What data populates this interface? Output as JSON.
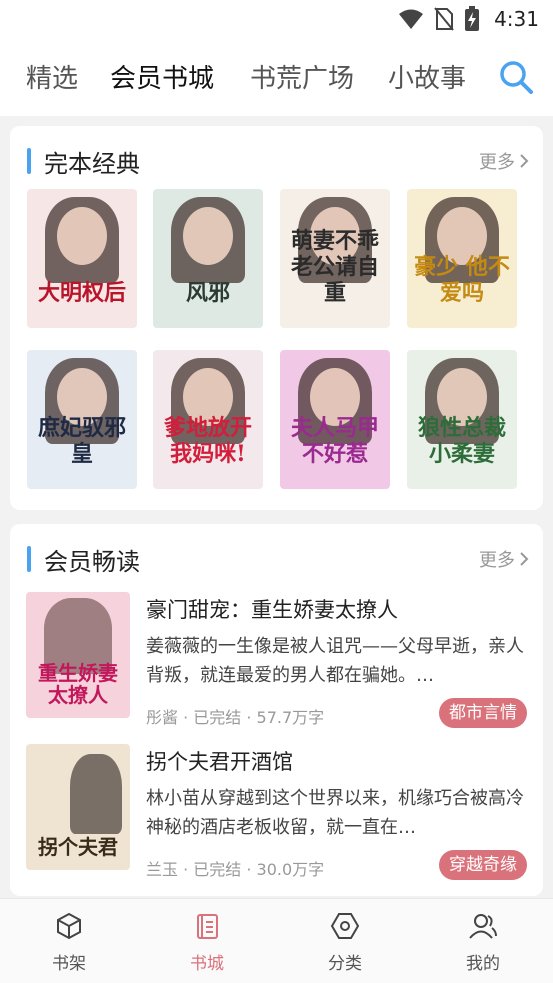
{
  "status_bar": {
    "time": "4:31"
  },
  "top_nav": {
    "tabs": [
      {
        "label": "精选",
        "active": false
      },
      {
        "label": "会员书城",
        "active": true
      },
      {
        "label": "书荒广场",
        "active": false
      },
      {
        "label": "小故事",
        "active": false
      }
    ],
    "search_icon": "search-icon",
    "accent_color": "#4aa3f0"
  },
  "section_classic": {
    "title": "完本经典",
    "more": "更多",
    "covers": [
      {
        "title": "大明权后",
        "bg": "#f6e6e6",
        "color": "#b8142a"
      },
      {
        "title": "风邪",
        "bg": "#dfe9e4",
        "color": "#2c3a36"
      },
      {
        "title": "萌妻不乖 老公请自重",
        "bg": "#f5efe8",
        "color": "#2b2b2b"
      },
      {
        "title": "豪少 他不爱吗",
        "bg": "#f7eed2",
        "color": "#c58a12"
      },
      {
        "title": "庶妃驭邪皇",
        "bg": "#e6ecf4",
        "color": "#1f2a44"
      },
      {
        "title": "爹地放开 我妈咪!",
        "bg": "#f3e8ec",
        "color": "#d21e3a"
      },
      {
        "title": "夫人马甲 不好惹",
        "bg": "#f1c9e6",
        "color": "#9a2a8f"
      },
      {
        "title": "狼性总裁 小柔妻",
        "bg": "#e8f0e8",
        "color": "#2d6d3a"
      }
    ]
  },
  "section_member": {
    "title": "会员畅读",
    "more": "更多",
    "books": [
      {
        "title": "豪门甜宠：重生娇妻太撩人",
        "desc": "姜薇薇的一生像是被人诅咒——父母早逝，亲人背叛，就连最爱的男人都在骗她。…",
        "meta": "彤酱 · 已完结 · 57.7万字",
        "tag": "都市言情",
        "cover_title": "重生娇妻 太撩人",
        "cover_bg": "#f6d2dc",
        "cover_color": "#c2185b"
      },
      {
        "title": "拐个夫君开酒馆",
        "desc": "林小苗从穿越到这个世界以来，机缘巧合被高冷神秘的酒店老板收留，就一直在…",
        "meta": "兰玉 · 已完结 · 30.0万字",
        "tag": "穿越奇缘",
        "cover_title": "拐个夫君",
        "cover_bg": "#efe4d2",
        "cover_color": "#3a2a1a"
      }
    ],
    "tag_color": "#d9727b"
  },
  "bottom_nav": {
    "items": [
      {
        "label": "书架",
        "icon": "cube-icon",
        "active": false
      },
      {
        "label": "书城",
        "icon": "book-icon",
        "active": true
      },
      {
        "label": "分类",
        "icon": "hexagon-icon",
        "active": false
      },
      {
        "label": "我的",
        "icon": "user-icon",
        "active": false
      }
    ],
    "active_color": "#d9727b"
  }
}
